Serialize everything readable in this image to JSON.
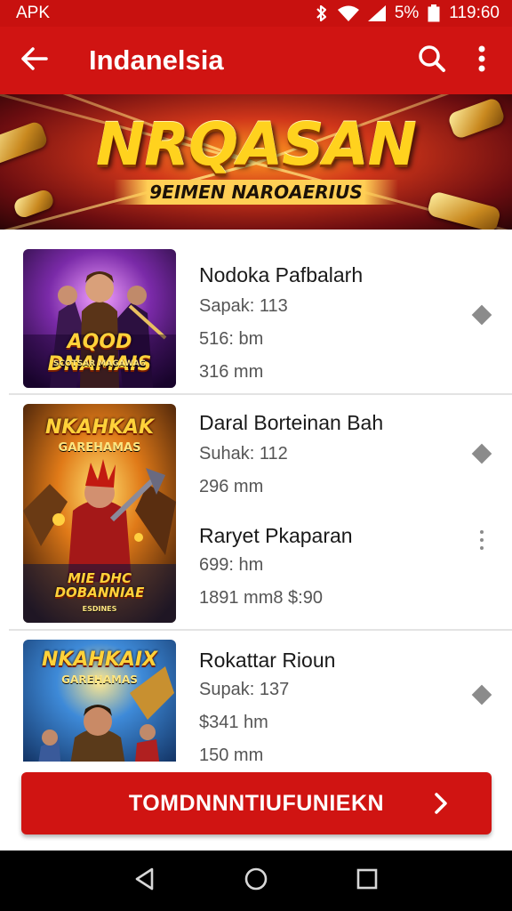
{
  "status_bar": {
    "app_label": "APK",
    "battery": "5%",
    "time": "119:60",
    "icons": [
      "bluetooth-icon",
      "wifi-icon",
      "signal-icon",
      "battery-icon"
    ]
  },
  "app_bar": {
    "title": "Indanelsia",
    "icons": [
      "back-arrow-icon",
      "search-icon",
      "more-vert-icon"
    ]
  },
  "banner": {
    "title": "NRQASAN",
    "subtitle": "9EIMEN NAROAERIUS"
  },
  "items": [
    {
      "thumb_title": "AQOD DNAMAIS",
      "thumb_sub": "SCOTSAR MAGAWAG",
      "title": "Nodoka Pafbalarh",
      "lines": [
        "Sapak: 113",
        "516: bm",
        "316 mm"
      ]
    },
    {
      "thumb_title": "NKAHKAK",
      "thumb_sub": "GAREHAMAS",
      "thumb_bottom": "MIE DHC DOBANNIAE",
      "thumb_tag": "ESDINES",
      "title": "Daral Borteinan Bah",
      "lines": [
        "Suhak: 112",
        "296 mm"
      ],
      "sub_title": "Raryet Pkaparan",
      "sub_lines": [
        "699: hm",
        "1891 mm8 $:90"
      ]
    },
    {
      "thumb_title": "NKAHKAIX",
      "thumb_sub": "GAREHAMAS",
      "title": "Rokattar Rioun",
      "lines": [
        "Supak: 137",
        "$341 hm",
        "150 mm"
      ]
    }
  ],
  "cta": {
    "label": "TOMDNNNTIUFUNIEKN",
    "icon": "chevron-right-icon"
  },
  "nav_bar": {
    "icons": [
      "nav-back-icon",
      "nav-home-icon",
      "nav-recents-icon"
    ]
  },
  "colors": {
    "primary_red": "#d01412",
    "status_red": "#c8110f",
    "banner_gold": "#ffd21e"
  }
}
